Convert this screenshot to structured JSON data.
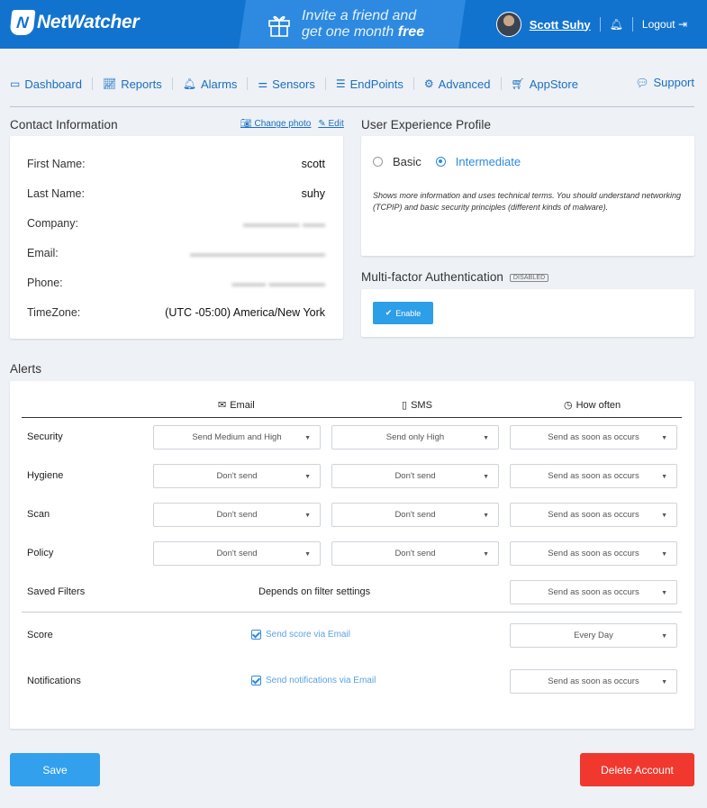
{
  "header": {
    "brand": "NetWatcher",
    "promo_line1": "Invite a friend and",
    "promo_line2_prefix": "get one month ",
    "promo_line2_bold": "free",
    "user_name": "Scott Suhy",
    "logout_label": "Logout",
    "color": "#1273cf"
  },
  "nav": {
    "items": [
      {
        "label": "Dashboard",
        "icon": "monitor-icon"
      },
      {
        "label": "Reports",
        "icon": "chart-icon"
      },
      {
        "label": "Alarms",
        "icon": "bell-icon"
      },
      {
        "label": "Sensors",
        "icon": "sliders-icon"
      },
      {
        "label": "EndPoints",
        "icon": "list-icon"
      },
      {
        "label": "Advanced",
        "icon": "gears-icon"
      },
      {
        "label": "AppStore",
        "icon": "cart-icon"
      }
    ],
    "support": "Support"
  },
  "contact": {
    "title": "Contact Information",
    "change_photo": "Change photo",
    "edit": "Edit",
    "fields": [
      {
        "label": "First Name:",
        "value": "scott"
      },
      {
        "label": "Last Name:",
        "value": "suhy"
      },
      {
        "label": "Company:",
        "value": ""
      },
      {
        "label": "Email:",
        "value": ""
      },
      {
        "label": "Phone:",
        "value": ""
      },
      {
        "label": "TimeZone:",
        "value": "(UTC -05:00) America/New York"
      }
    ]
  },
  "ux": {
    "title": "User Experience Profile",
    "basic": "Basic",
    "intermediate": "Intermediate",
    "selected": "Intermediate",
    "description": "Shows more information and uses technical terms. You should understand networking (TCPIP) and basic security principles (different kinds of malware)."
  },
  "mfa": {
    "title": "Multi-factor Authentication",
    "badge": "DISABLED",
    "button": "Enable"
  },
  "alerts": {
    "title": "Alerts",
    "columns": {
      "email": "Email",
      "sms": "SMS",
      "how_often": "How often"
    },
    "rows": [
      {
        "label": "Security",
        "email": "Send Medium and High",
        "sms": "Send only High",
        "often": "Send as soon as occurs"
      },
      {
        "label": "Hygiene",
        "email": "Don't send",
        "sms": "Don't send",
        "often": "Send as soon as occurs"
      },
      {
        "label": "Scan",
        "email": "Don't send",
        "sms": "Don't send",
        "often": "Send as soon as occurs"
      },
      {
        "label": "Policy",
        "email": "Don't send",
        "sms": "Don't send",
        "often": "Send as soon as occurs"
      }
    ],
    "saved_filters": {
      "label": "Saved Filters",
      "text": "Depends on filter settings",
      "often": "Send as soon as occurs"
    },
    "score": {
      "label": "Score",
      "check": "Send score via Email",
      "often": "Every Day"
    },
    "notifications": {
      "label": "Notifications",
      "check": "Send notifications via Email",
      "often": "Send as soon as occurs"
    }
  },
  "actions": {
    "save": "Save",
    "delete": "Delete Account"
  }
}
